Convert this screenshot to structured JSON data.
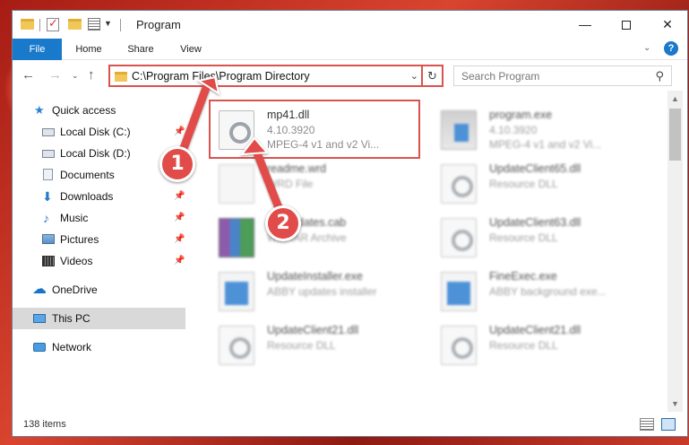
{
  "window": {
    "title": "Program",
    "controls": {
      "minimize": "—",
      "maximize": "",
      "close": "✕"
    }
  },
  "ribbon": {
    "tabs": [
      "File",
      "Home",
      "Share",
      "View"
    ],
    "expand_glyph": "⌄",
    "help_glyph": "?"
  },
  "nav": {
    "back_glyph": "←",
    "forward_glyph": "→",
    "history_glyph": "⌄",
    "up_glyph": "↑",
    "address": "C:\\Program Files\\Program Directory",
    "address_dropdown_glyph": "⌄",
    "refresh_glyph": "↻",
    "search_placeholder": "Search Program",
    "search_glyph": "⚲"
  },
  "sidebar": {
    "items": [
      {
        "label": "Quick access",
        "icon": "star-icon",
        "pinned": false
      },
      {
        "label": "Local Disk (C:)",
        "icon": "disk-icon",
        "pinned": true
      },
      {
        "label": "Local Disk (D:)",
        "icon": "disk-icon",
        "pinned": false
      },
      {
        "label": "Documents",
        "icon": "documents-icon",
        "pinned": true
      },
      {
        "label": "Downloads",
        "icon": "download-icon",
        "pinned": true
      },
      {
        "label": "Music",
        "icon": "music-icon",
        "pinned": true
      },
      {
        "label": "Pictures",
        "icon": "pictures-icon",
        "pinned": true
      },
      {
        "label": "Videos",
        "icon": "videos-icon",
        "pinned": true
      },
      {
        "label": "OneDrive",
        "icon": "cloud-icon",
        "pinned": false
      },
      {
        "label": "This PC",
        "icon": "pc-icon",
        "pinned": false,
        "selected": true
      },
      {
        "label": "Network",
        "icon": "network-icon",
        "pinned": false
      }
    ],
    "pin_glyph": "📌"
  },
  "files": [
    {
      "name": "mp41.dll",
      "line1": "4.10.3920",
      "line2": "MPEG-4 v1 and v2 Vi...",
      "icon": "dll-gear-icon",
      "highlighted": true
    },
    {
      "name": "program.exe",
      "line1": "4.10.3920",
      "line2": "MPEG-4 v1 and v2 Vi...",
      "icon": "program-exe-icon"
    },
    {
      "name": "readme.wrd",
      "line1": "WRD File",
      "line2": "",
      "icon": "document-icon"
    },
    {
      "name": "UpdateClient65.dll",
      "line1": "Resource DLL",
      "line2": "",
      "icon": "dll-gear-icon"
    },
    {
      "name": "ourUpdates.cab",
      "line1": "WinRAR Archive",
      "line2": "",
      "icon": "archive-icon"
    },
    {
      "name": "UpdateClient63.dll",
      "line1": "Resource DLL",
      "line2": "",
      "icon": "dll-gear-icon"
    },
    {
      "name": "UpdateInstaller.exe",
      "line1": "ABBY updates installer",
      "line2": "",
      "icon": "exe-icon"
    },
    {
      "name": "FineExec.exe",
      "line1": "ABBY background exe...",
      "line2": "",
      "icon": "exe-icon"
    },
    {
      "name": "UpdateClient21.dll",
      "line1": "Resource DLL",
      "line2": "",
      "icon": "dll-gear-icon"
    },
    {
      "name": "UpdateClient21.dll",
      "line1": "Resource DLL",
      "line2": "",
      "icon": "dll-gear-icon"
    }
  ],
  "status": {
    "item_count": "138 items"
  },
  "callouts": {
    "step1": "1",
    "step2": "2",
    "color": "#e14b49"
  },
  "colors": {
    "accent": "#1979ca",
    "highlight_border": "#d9534f"
  }
}
